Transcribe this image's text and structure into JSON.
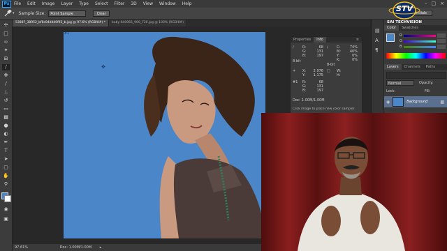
{
  "menu": {
    "items": [
      "File",
      "Edit",
      "Image",
      "Layer",
      "Type",
      "Select",
      "Filter",
      "3D",
      "View",
      "Window",
      "Help"
    ],
    "app_badge": "Ps"
  },
  "options": {
    "sample_size_label": "Sample Size:",
    "sample_size_value": "Point Sample",
    "clear_label": "Clear",
    "right_label": "Essentials"
  },
  "tabs": [
    {
      "label": "53887_38952_bf6c04ddd0f93_b.jpg @ 97.6% (RGB/8#) *"
    },
    {
      "label": "baby-640065_960_720.jpg @ 100% (RGB/8#)"
    }
  ],
  "canvas": {
    "sampler_marker": "#1"
  },
  "status": {
    "zoom": "97.61%",
    "doc": "Doc: 1.00M/1.00M"
  },
  "info_panel": {
    "tabs": [
      "Properties",
      "Info"
    ],
    "active_tab": "Info",
    "rgb": {
      "R": "68",
      "G": "131",
      "B": "197"
    },
    "cmyk": {
      "C": "74%",
      "M": "40%",
      "Y": "0%",
      "K": "0%"
    },
    "bit_left": "8-bit",
    "bit_right": "8-bit",
    "xy": {
      "X": "2.976",
      "Y": "1.175"
    },
    "wh": {
      "W": "",
      "H": ""
    },
    "sample1_label": "#1",
    "sample1": {
      "R": "68",
      "G": "131",
      "B": "197"
    },
    "doc": "Doc: 1.00M/1.00M",
    "hint": "Click image to place new color sampler."
  },
  "color_panel": {
    "tabs": [
      "Color",
      "Swatches"
    ],
    "rows": [
      {
        "ch": "R",
        "val": ""
      },
      {
        "ch": "G",
        "val": ""
      },
      {
        "ch": "B",
        "val": ""
      }
    ]
  },
  "layers_panel": {
    "tabs": [
      "Layers",
      "Channels",
      "Paths"
    ],
    "blend_mode": "Normal",
    "opacity_label": "Opacity:",
    "lock_label": "Lock:",
    "fill_label": "Fill:",
    "layer_name": "Background"
  },
  "logo": {
    "text": "STV",
    "caption": "SAI TECHVISION"
  },
  "colors": {
    "canvas_blue": "#4a86c8",
    "ps_blue": "#31a8ff",
    "curtain": "#6a1414"
  }
}
